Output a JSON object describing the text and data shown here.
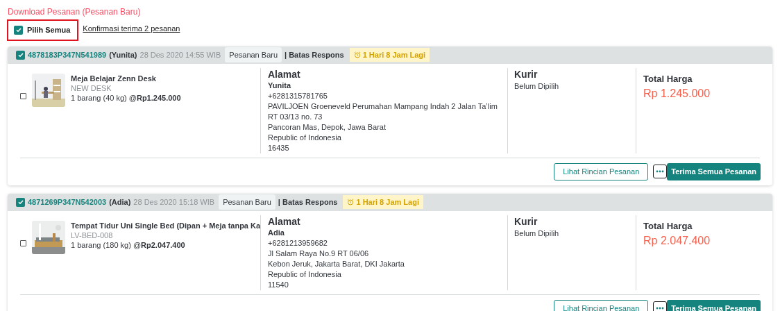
{
  "download_link": "Download Pesanan (Pesanan Baru)",
  "select_all": {
    "label": "Pilih Semua",
    "checked": true,
    "highlighted": true
  },
  "confirm_link": "Konfirmasi terima 2 pesanan",
  "orders": [
    {
      "checked": true,
      "invoice": "4878183P347N541989",
      "buyer": "(Yunita)",
      "date": "28 Des 2020 14:55 WIB",
      "status": "Pesanan Baru",
      "deadline_label": "| Batas Respons",
      "deadline": "1 Hari 8 Jam Lagi",
      "product": {
        "checked": false,
        "name": "Meja Belajar Zenn Desk",
        "sku": "NEW DESK",
        "qty": "1 barang (40 kg) @**Rp1.245.000**"
      },
      "address": {
        "title": "Alamat",
        "name": "Yunita",
        "lines": [
          "+6281315781765",
          "PAVILJOEN Groeneveld Perumahan Mampang Indah 2 Jalan Ta’lim",
          "RT 03/13 no. 73",
          "Pancoran Mas, Depok, Jawa Barat",
          "Republic of Indonesia",
          "16435"
        ]
      },
      "courier": {
        "title": "Kurir",
        "value": "Belum Dipilih"
      },
      "total": {
        "title": "Total Harga",
        "value": "Rp 1.245.000"
      },
      "buttons": {
        "details": "Lihat Rincian Pesanan",
        "accept": "Terima Semua Pesanan"
      }
    },
    {
      "checked": true,
      "invoice": "4871269P347N542003",
      "buyer": "(Adia)",
      "date": "28 Des 2020 15:18 WIB",
      "status": "Pesanan Baru",
      "deadline_label": "| Batas Respons",
      "deadline": "1 Hari 8 Jam Lagi",
      "product": {
        "checked": false,
        "name": "Tempat Tidur Uni Single Bed (Dipan + Meja tanpa Ka",
        "sku": "LV-BED-008",
        "qty": "1 barang (180 kg) @**Rp2.047.400**"
      },
      "address": {
        "title": "Alamat",
        "name": "Adia",
        "lines": [
          "+6281213959682",
          "Jl Salam Raya No.9 RT 06/06",
          "Kebon Jeruk, Jakarta Barat, DKI Jakarta",
          "Republic of Indonesia",
          "11540"
        ]
      },
      "courier": {
        "title": "Kurir",
        "value": "Belum Dipilih"
      },
      "total": {
        "title": "Total Harga",
        "value": "Rp 2.047.400"
      },
      "buttons": {
        "details": "Lihat Rincian Pesanan",
        "accept": "Terima Semua Pesanan"
      }
    }
  ]
}
